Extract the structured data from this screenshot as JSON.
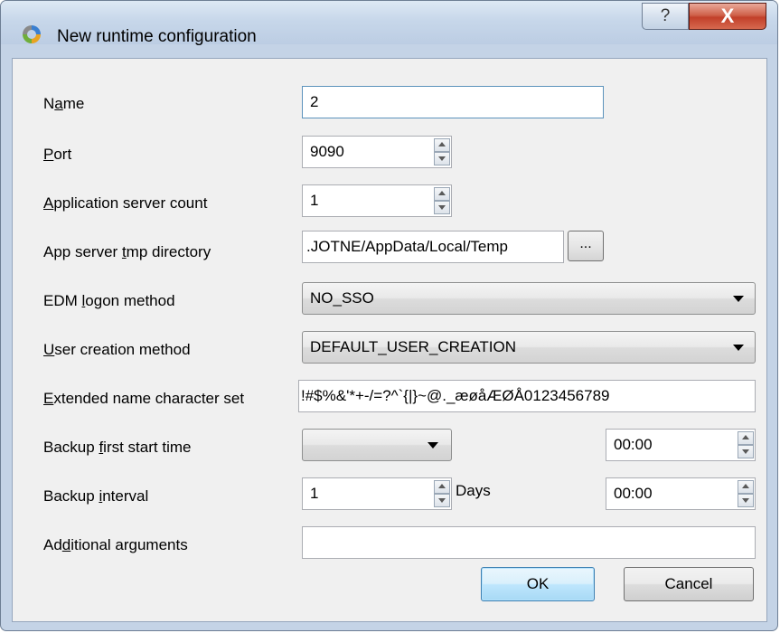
{
  "window": {
    "title": "New runtime configuration",
    "help_glyph": "?",
    "close_glyph": "X"
  },
  "labels": {
    "name": [
      "N",
      "a",
      "me"
    ],
    "port": [
      "",
      "P",
      "ort"
    ],
    "app_server_count": [
      "",
      "A",
      "pplication server count"
    ],
    "tmp_dir": [
      "App server ",
      "t",
      "mp directory"
    ],
    "edm_logon": [
      "EDM ",
      "l",
      "ogon method"
    ],
    "user_creation": [
      "",
      "U",
      "ser creation method"
    ],
    "ext_charset": [
      "",
      "E",
      "xtended name character set"
    ],
    "backup_first": [
      "Backup ",
      "f",
      "irst start time"
    ],
    "backup_interval": [
      "Backup ",
      "i",
      "nterval"
    ],
    "additional_args": [
      "Ad",
      "d",
      "itional arguments"
    ]
  },
  "fields": {
    "name": "2",
    "port": "9090",
    "app_server_count": "1",
    "tmp_dir": ".JOTNE/AppData/Local/Temp",
    "browse_label": "...",
    "edm_logon": "NO_SSO",
    "user_creation": "DEFAULT_USER_CREATION",
    "ext_charset": "!#$%&'*+-/=?^`{|}~@._æøåÆØÅ0123456789",
    "backup_first_date": "",
    "backup_first_time": "00:00",
    "backup_interval": "1",
    "backup_interval_unit": "Days",
    "backup_interval_time": "00:00",
    "additional_args": ""
  },
  "buttons": {
    "ok": "OK",
    "cancel": "Cancel"
  },
  "colors": {
    "frame": "#c4d3e6",
    "client": "#f0f0f0",
    "close_button": "#c2402a",
    "default_button": "#bee6fd"
  }
}
